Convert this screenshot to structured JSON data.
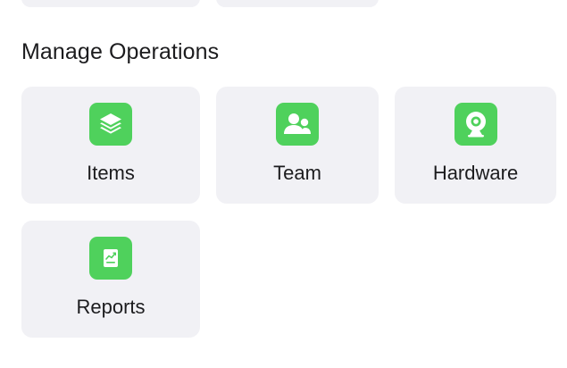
{
  "section": {
    "title": "Manage Operations"
  },
  "tiles": [
    {
      "label": "Items",
      "icon": "layers-icon"
    },
    {
      "label": "Team",
      "icon": "people-icon"
    },
    {
      "label": "Hardware",
      "icon": "webcam-icon"
    },
    {
      "label": "Reports",
      "icon": "report-chart-icon"
    }
  ],
  "colors": {
    "accent": "#4fd15c",
    "tile_background": "#f1f1f5",
    "text": "#1c1c1e"
  }
}
